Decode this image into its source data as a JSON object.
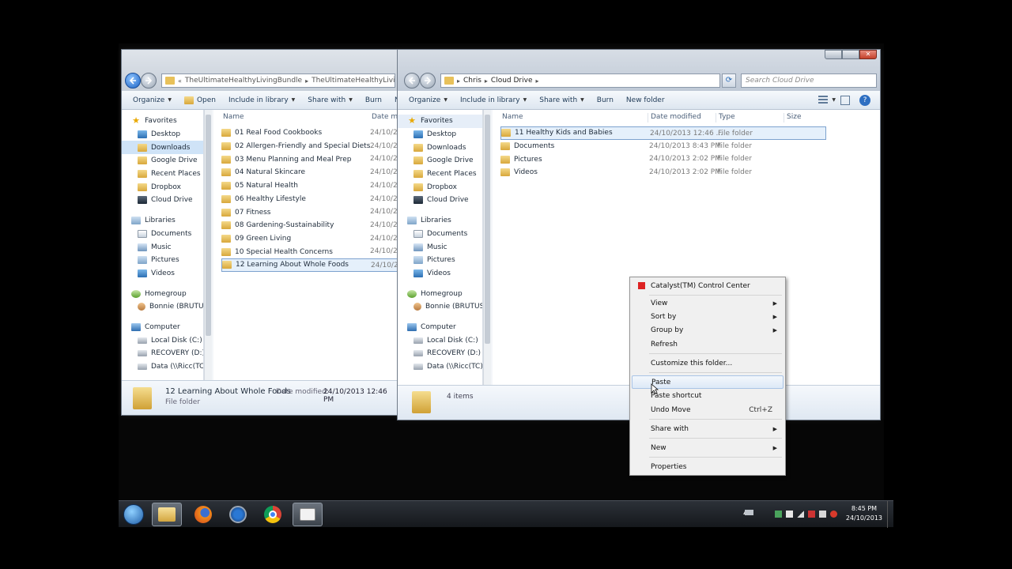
{
  "left_window": {
    "breadcrumb": [
      "TheUltimateHealthyLivingBundle",
      "TheUltimateHealthyLivingBundle"
    ],
    "toolbar": [
      "Organize",
      "Open",
      "Include in library",
      "Share with",
      "Burn",
      "N"
    ],
    "nav": {
      "favorites_label": "Favorites",
      "favorites": [
        "Desktop",
        "Downloads",
        "Google Drive",
        "Recent Places",
        "Dropbox",
        "Cloud Drive"
      ],
      "libraries_label": "Libraries",
      "libraries": [
        "Documents",
        "Music",
        "Pictures",
        "Videos"
      ],
      "homegroup_label": "Homegroup",
      "homegroup": [
        "Bonnie (BRUTUS)"
      ],
      "computer_label": "Computer",
      "computer": [
        "Local Disk (C:)",
        "RECOVERY (D:)",
        "Data (\\\\Ricc(TC)"
      ]
    },
    "columns": {
      "name": "Name",
      "date": "Date mod"
    },
    "files": [
      {
        "name": "01 Real Food Cookbooks",
        "date": "24/10/2"
      },
      {
        "name": "02 Allergen-Friendly and Special Diets",
        "date": "24/10/2"
      },
      {
        "name": "03 Menu Planning and Meal Prep",
        "date": "24/10/2"
      },
      {
        "name": "04 Natural Skincare",
        "date": "24/10/2"
      },
      {
        "name": "05 Natural Health",
        "date": "24/10/2"
      },
      {
        "name": "06 Healthy Lifestyle",
        "date": "24/10/2"
      },
      {
        "name": "07 Fitness",
        "date": "24/10/2"
      },
      {
        "name": "08 Gardening-Sustainability",
        "date": "24/10/2"
      },
      {
        "name": "09 Green Living",
        "date": "24/10/2"
      },
      {
        "name": "10 Special Health Concerns",
        "date": "24/10/2"
      },
      {
        "name": "12 Learning About Whole Foods",
        "date": "24/10/2"
      }
    ],
    "details": {
      "name": "12 Learning About Whole Foods",
      "date_label": "Date modified:",
      "date_value": "24/10/2013 12:46 PM",
      "type": "File folder"
    }
  },
  "right_window": {
    "breadcrumb": [
      "Chris",
      "Cloud Drive"
    ],
    "search_placeholder": "Search Cloud Drive",
    "toolbar": [
      "Organize",
      "Include in library",
      "Share with",
      "Burn",
      "New folder"
    ],
    "nav": {
      "favorites_label": "Favorites",
      "favorites": [
        "Desktop",
        "Downloads",
        "Google Drive",
        "Recent Places",
        "Dropbox",
        "Cloud Drive"
      ],
      "libraries_label": "Libraries",
      "libraries": [
        "Documents",
        "Music",
        "Pictures",
        "Videos"
      ],
      "homegroup_label": "Homegroup",
      "homegroup": [
        "Bonnie (BRUTUS)"
      ],
      "computer_label": "Computer",
      "computer": [
        "Local Disk (C:)",
        "RECOVERY (D:)",
        "Data (\\\\Ricc(TC)"
      ]
    },
    "columns": {
      "name": "Name",
      "date": "Date modified",
      "type": "Type",
      "size": "Size"
    },
    "files": [
      {
        "name": "11 Healthy Kids and Babies",
        "date": "24/10/2013 12:46 ...",
        "type": "File folder"
      },
      {
        "name": "Documents",
        "date": "24/10/2013 8:43 PM",
        "type": "File folder"
      },
      {
        "name": "Pictures",
        "date": "24/10/2013 2:02 PM",
        "type": "File folder"
      },
      {
        "name": "Videos",
        "date": "24/10/2013 2:02 PM",
        "type": "File folder"
      }
    ],
    "status": "4 items"
  },
  "context_menu": {
    "catalyst": "Catalyst(TM) Control Center",
    "view": "View",
    "sort_by": "Sort by",
    "group_by": "Group by",
    "refresh": "Refresh",
    "customize": "Customize this folder...",
    "paste": "Paste",
    "paste_shortcut": "Paste shortcut",
    "undo_move": "Undo Move",
    "undo_shortcut": "Ctrl+Z",
    "share_with": "Share with",
    "new": "New",
    "properties": "Properties"
  },
  "taskbar": {
    "time": "8:45 PM",
    "date": "24/10/2013"
  }
}
